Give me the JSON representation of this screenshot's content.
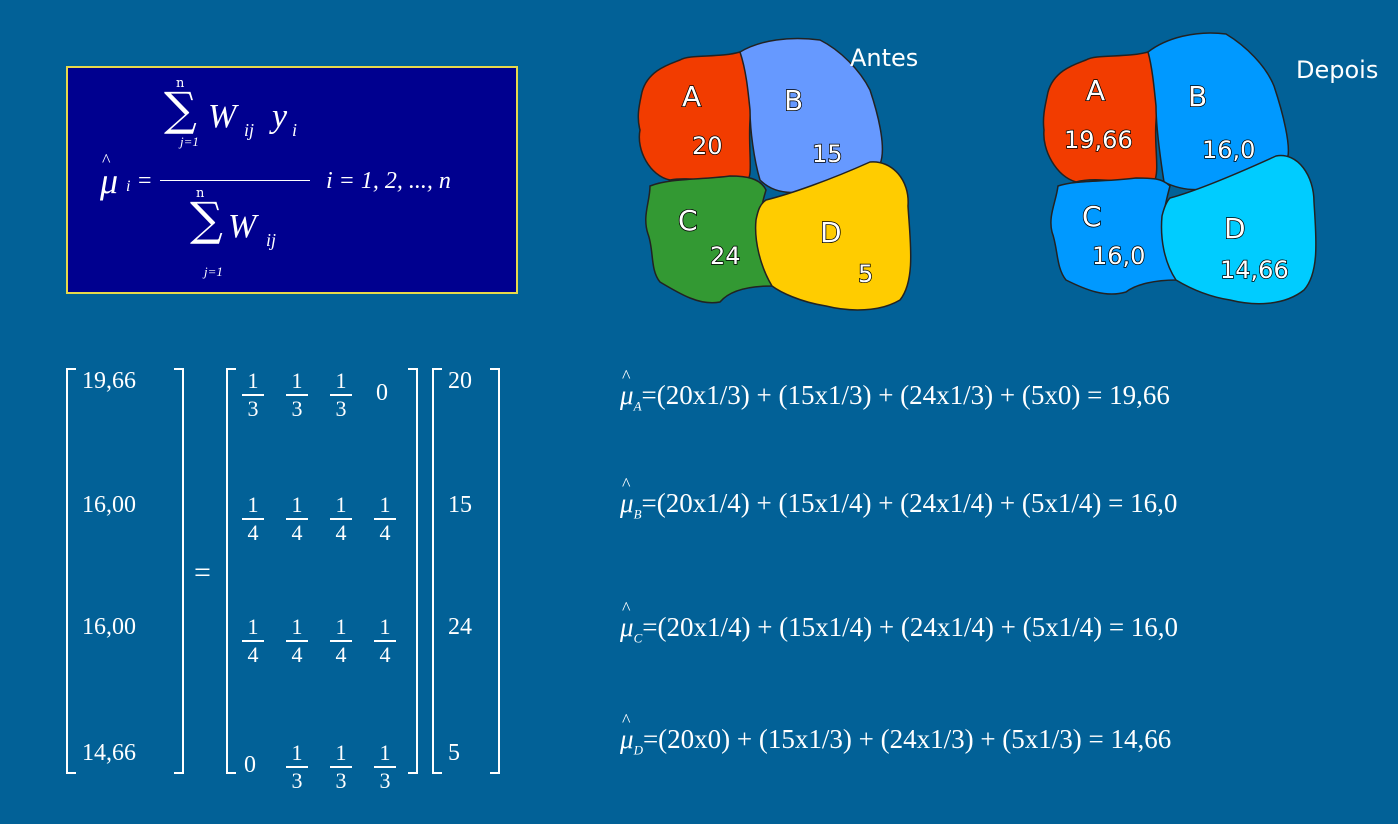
{
  "formula": {
    "mu": "μ",
    "i_sub": "i",
    "equals": "=",
    "sum": "∑",
    "n": "n",
    "j1": "j=1",
    "numerator_w": "W",
    "numerator_ij": "ij",
    "numerator_y": "y",
    "numerator_i": "i",
    "denominator_w": "W",
    "denominator_ij": "ij",
    "range": "i = 1, 2, ..., n"
  },
  "maps": {
    "before": {
      "title": "Antes",
      "regions": [
        {
          "letter": "A",
          "value": "20",
          "color": "#f23c00"
        },
        {
          "letter": "B",
          "value": "15",
          "color": "#6699ff"
        },
        {
          "letter": "C",
          "value": "24",
          "color": "#339933"
        },
        {
          "letter": "D",
          "value": "5",
          "color": "#ffcc00"
        }
      ]
    },
    "after": {
      "title": "Depois",
      "regions": [
        {
          "letter": "A",
          "value": "19,66",
          "color": "#f23c00"
        },
        {
          "letter": "B",
          "value": "16,0",
          "color": "#0099ff"
        },
        {
          "letter": "C",
          "value": "16,0",
          "color": "#0099ff"
        },
        {
          "letter": "D",
          "value": "14,66",
          "color": "#00ccff"
        }
      ]
    }
  },
  "matrix": {
    "result": [
      "19,66",
      "16,00",
      "16,00",
      "14,66"
    ],
    "equals": "=",
    "weights": [
      [
        {
          "n": "1",
          "d": "3"
        },
        {
          "n": "1",
          "d": "3"
        },
        {
          "n": "1",
          "d": "3"
        },
        {
          "v": "0"
        }
      ],
      [
        {
          "n": "1",
          "d": "4"
        },
        {
          "n": "1",
          "d": "4"
        },
        {
          "n": "1",
          "d": "4"
        },
        {
          "n": "1",
          "d": "4"
        }
      ],
      [
        {
          "n": "1",
          "d": "4"
        },
        {
          "n": "1",
          "d": "4"
        },
        {
          "n": "1",
          "d": "4"
        },
        {
          "n": "1",
          "d": "4"
        }
      ],
      [
        {
          "v": "0"
        },
        {
          "n": "1",
          "d": "3"
        },
        {
          "n": "1",
          "d": "3"
        },
        {
          "n": "1",
          "d": "3"
        }
      ]
    ],
    "values": [
      "20",
      "15",
      "24",
      "5"
    ]
  },
  "equations": [
    {
      "sub": "A",
      "expr": "=(20x1/3) + (15x1/3) + (24x1/3) + (5x0) =  19,66"
    },
    {
      "sub": "B",
      "expr": "=(20x1/4) + (15x1/4) + (24x1/4) + (5x1/4) =  16,0"
    },
    {
      "sub": "C",
      "expr": "=(20x1/4) + (15x1/4) + (24x1/4) + (5x1/4) =  16,0"
    },
    {
      "sub": "D",
      "expr": "=(20x0) + (15x1/3) + (24x1/3) + (5x1/3) =  14,66"
    }
  ]
}
